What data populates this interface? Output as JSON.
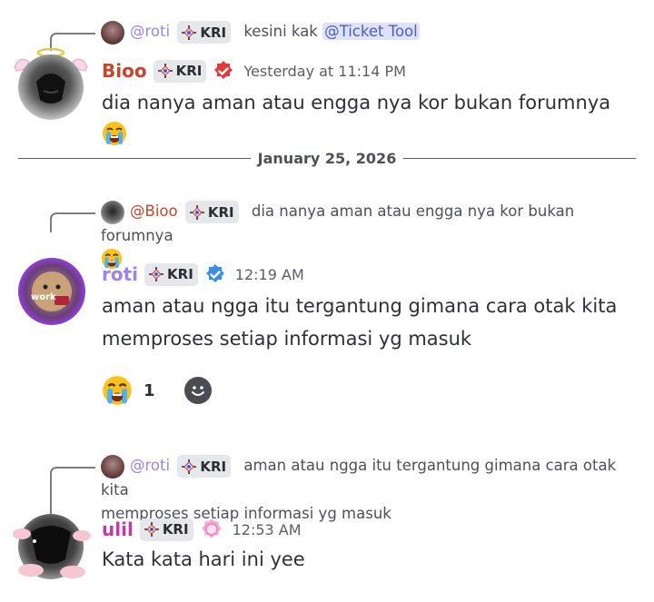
{
  "colors": {
    "bioo": "#c7452d",
    "roti": "#9b84ee",
    "ulil": "#c23aa3",
    "mention_bg": "#dfe2fd",
    "mention_fg": "#4f5eb5"
  },
  "messages": [
    {
      "reply": {
        "author": "@roti",
        "tag": "KRI",
        "text": "kesini kak",
        "ping": "@Ticket Tool"
      },
      "author": "Bioo",
      "tag": "KRI",
      "badge_icon": "red-verified-badge-icon",
      "time": "Yesterday at 11:14 PM",
      "content": "dia nanya aman atau engga nya kor bukan forumnya"
    },
    {
      "reply": {
        "author": "@Bioo",
        "tag": "KRI",
        "text": "dia nanya aman atau engga nya kor bukan forumnya"
      },
      "author": "roti",
      "tag": "KRI",
      "badge_icon": "blue-verified-badge-icon",
      "time": "12:19 AM",
      "content_line1": "aman atau ngga itu tergantung gimana cara otak kita",
      "content_line2": "memproses setiap informasi yg masuk",
      "reaction": {
        "emoji": "loudly-crying-face",
        "count": "1"
      }
    },
    {
      "reply": {
        "author": "@roti",
        "tag": "KRI",
        "text_line1": "aman atau ngga itu tergantung gimana cara otak kita",
        "text_line2": "memproses setiap informasi yg masuk"
      },
      "author": "ulil",
      "tag": "KRI",
      "badge_icon": "pink-badge-icon",
      "time": "12:53 AM",
      "content": "Kata kata hari ini yee"
    }
  ],
  "divider": {
    "date": "January 25, 2026"
  }
}
